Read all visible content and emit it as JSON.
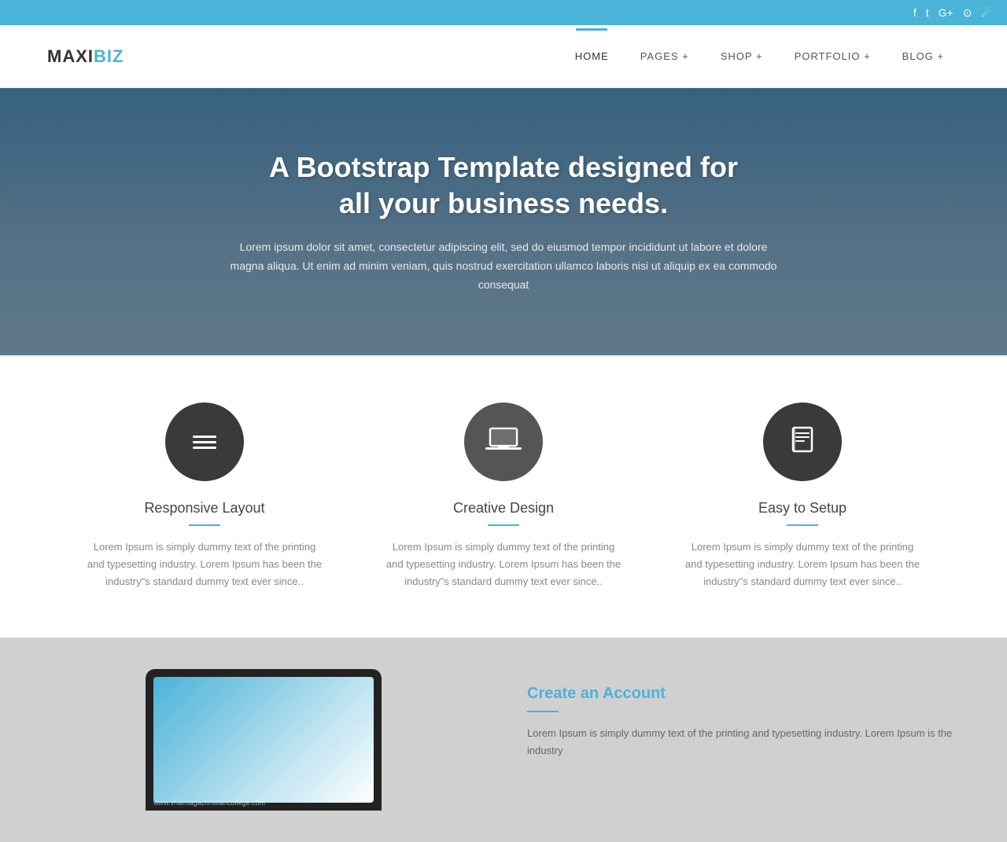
{
  "topbar": {
    "social_icons": [
      "f",
      "t",
      "g+",
      "⊙",
      "rss"
    ]
  },
  "header": {
    "logo_maxi": "MAXI",
    "logo_biz": "BIZ",
    "nav_items": [
      {
        "label": "HOME",
        "active": true
      },
      {
        "label": "PAGES +",
        "active": false
      },
      {
        "label": "SHOP +",
        "active": false
      },
      {
        "label": "PORTFOLIO +",
        "active": false
      },
      {
        "label": "BLOG +",
        "active": false
      }
    ]
  },
  "hero": {
    "title": "A Bootstrap Template designed for\nall your business needs.",
    "description": "Lorem ipsum dolor sit amet, consectetur adipiscing elit, sed do eiusmod tempor incididunt ut labore et dolore magna aliqua. Ut enim ad minim veniam, quis nostrud exercitation ullamco laboris nisi ut aliquip ex ea commodo consequat"
  },
  "features": [
    {
      "icon": "≡",
      "title": "Responsive Layout",
      "description": "Lorem Ipsum is simply dummy text of the printing and typesetting industry. Lorem Ipsum has been the industry\"s standard dummy text ever since.."
    },
    {
      "icon": "⬛",
      "title": "Creative Design",
      "description": "Lorem Ipsum is simply dummy text of the printing and typesetting industry. Lorem Ipsum has been the industry\"s standard dummy text ever since.."
    },
    {
      "icon": "📋",
      "title": "Easy to Setup",
      "description": "Lorem Ipsum is simply dummy text of the printing and typesetting industry. Lorem Ipsum has been the industry\"s standard dummy text ever since.."
    }
  ],
  "bottom": {
    "title": "Create an Account",
    "description": "Lorem Ipsum is simply dummy text of the printing and typesetting industry. Lorem Ipsum is the industry"
  },
  "watermark": "www.vhaintagachristiancollege.com"
}
